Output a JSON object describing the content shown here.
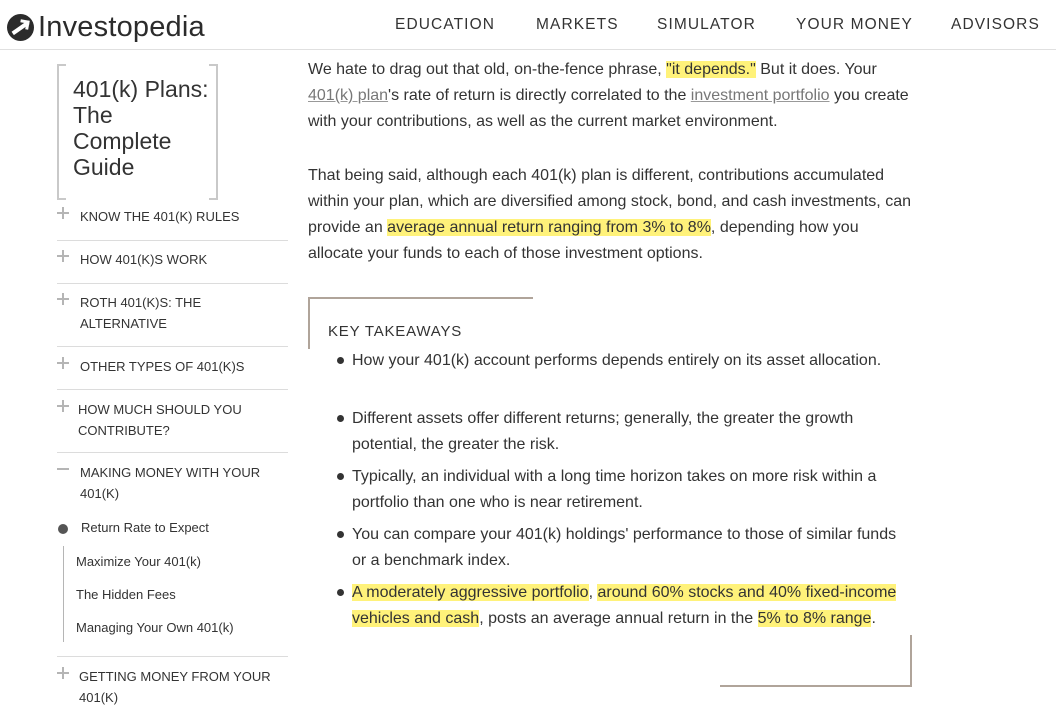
{
  "header": {
    "logo_text": "Investopedia",
    "nav": [
      "EDUCATION",
      "MARKETS",
      "SIMULATOR",
      "YOUR MONEY",
      "ADVISORS"
    ]
  },
  "sidebar": {
    "guide_title": "401(k) Plans: The Complete Guide",
    "items": [
      {
        "label": "KNOW THE 401(K) RULES",
        "icon": "plus-icon"
      },
      {
        "label": "HOW 401(K)S WORK",
        "icon": "plus-icon"
      },
      {
        "label": "ROTH 401(K)S: THE ALTERNATIVE",
        "icon": "plus-icon"
      },
      {
        "label": "OTHER TYPES OF 401(K)S",
        "icon": "plus-icon"
      },
      {
        "label": "HOW MUCH SHOULD YOU CONTRIBUTE?",
        "icon": "plus-icon"
      },
      {
        "label": "MAKING MONEY WITH YOUR 401(K)",
        "icon": "minus-icon"
      },
      {
        "label": "GETTING MONEY FROM YOUR 401(K)",
        "icon": "plus-icon"
      }
    ],
    "current_page": "Return Rate to Expect",
    "sub_items": [
      "Maximize Your 401(k)",
      "The Hidden Fees",
      "Managing Your Own 401(k)"
    ]
  },
  "article": {
    "p1": {
      "a": "We hate to drag out that old, on-the-fence phrase, ",
      "hl": "\"it depends.\"",
      "b": " But it does. Your ",
      "link1": "401(k) plan",
      "c": "'s rate of return is directly correlated to the ",
      "link2": "investment portfolio",
      "d": " you create with your contributions, as well as the current market environment."
    },
    "p2": {
      "a": "That being said, although each 401(k) plan is different, contributions accumulated within your plan, which are diversified among stock, bond, and cash investments, can provide an ",
      "hl": "average annual return ranging from 3% to 8%",
      "b": ", depending how you allocate your funds to each of those investment options."
    },
    "takeaways": {
      "heading": "KEY TAKEAWAYS",
      "items": [
        "How your 401(k) account performs depends entirely on its asset allocation.",
        "Different assets offer different returns; generally, the greater the growth potential, the greater the risk.",
        "Typically, an individual with a long time horizon takes on more risk within a portfolio than one who is near retirement.",
        "You can compare your 401(k) holdings' performance to those of similar funds or a benchmark index."
      ],
      "last": {
        "hl1": "A moderately aggressive portfolio",
        "sep": ", ",
        "hl2": "around 60% stocks and 40% fixed-income vehicles and cash",
        "mid": ", posts an average annual return in the ",
        "hl3": "5% to 8% range",
        "end": "."
      }
    }
  },
  "colors": {
    "highlight": "#fff27a",
    "accent_line": "#b0a49a"
  }
}
